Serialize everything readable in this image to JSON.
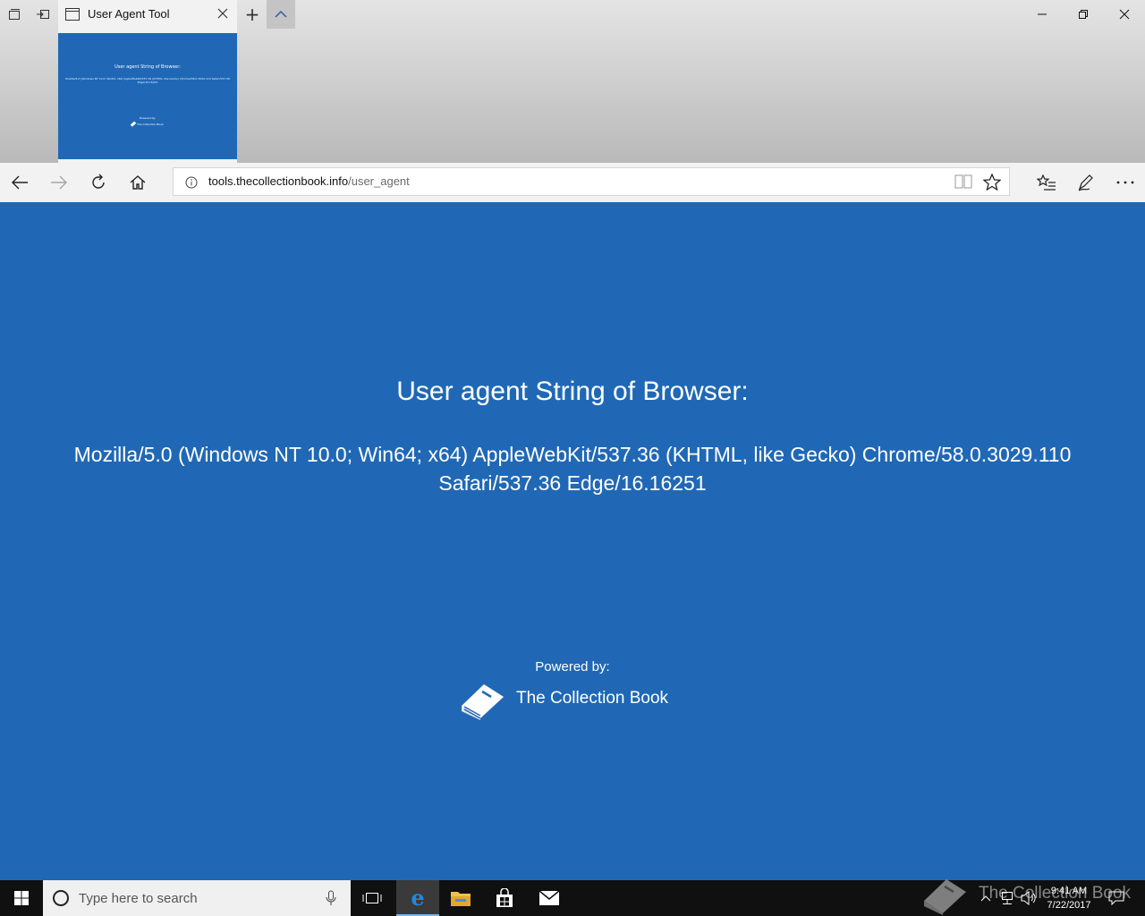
{
  "browser": {
    "tab": {
      "title": "User Agent Tool",
      "close_label": "×"
    },
    "new_tab_label": "+",
    "address": {
      "host": "tools.thecollectionbook.info",
      "path": "/user_agent"
    }
  },
  "page": {
    "heading": "User agent String of Browser:",
    "user_agent": "Mozilla/5.0 (Windows NT 10.0; Win64; x64) AppleWebKit/537.36 (KHTML, like Gecko) Chrome/58.0.3029.110 Safari/537.36 Edge/16.16251",
    "powered_by": "Powered by:",
    "brand": "The Collection Book"
  },
  "taskbar": {
    "search_placeholder": "Type here to search",
    "time": "9:41 AM",
    "date": "7/22/2017",
    "apps": [
      "task-view",
      "edge",
      "file-explorer",
      "store",
      "mail"
    ]
  },
  "watermark": "The Collection Book",
  "colors": {
    "page_bg": "#2068b5",
    "chrome_bg": "#f2f2f2",
    "taskbar_bg": "#101010",
    "accent": "#76b9ed"
  }
}
